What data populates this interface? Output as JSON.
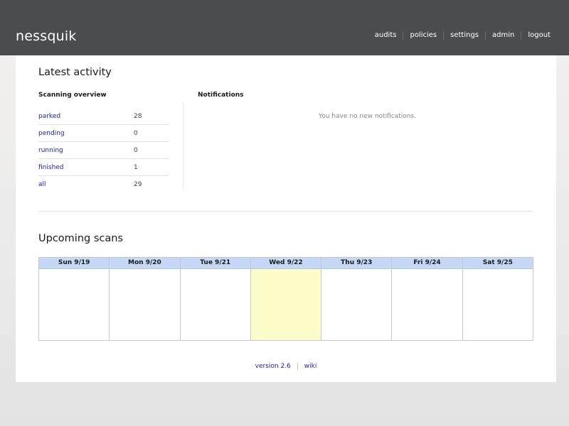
{
  "header": {
    "brand": "nessquik",
    "nav": [
      {
        "label": "audits"
      },
      {
        "label": "policies"
      },
      {
        "label": "settings"
      },
      {
        "label": "admin"
      },
      {
        "label": "logout"
      }
    ]
  },
  "latest_activity": {
    "title": "Latest activity",
    "scanning_overview": {
      "heading": "Scanning overview",
      "rows": [
        {
          "label": "parked",
          "count": "28"
        },
        {
          "label": "pending",
          "count": "0"
        },
        {
          "label": "running",
          "count": "0"
        },
        {
          "label": "finished",
          "count": "1"
        },
        {
          "label": "all",
          "count": "29"
        }
      ]
    },
    "notifications": {
      "heading": "Notifications",
      "empty_text": "You have no new notifications."
    }
  },
  "upcoming_scans": {
    "title": "Upcoming scans",
    "days": [
      {
        "label": "Sun 9/19",
        "today": false
      },
      {
        "label": "Mon 9/20",
        "today": false
      },
      {
        "label": "Tue 9/21",
        "today": false
      },
      {
        "label": "Wed 9/22",
        "today": true
      },
      {
        "label": "Thu 9/23",
        "today": false
      },
      {
        "label": "Fri 9/24",
        "today": false
      },
      {
        "label": "Sat 9/25",
        "today": false
      }
    ]
  },
  "footer": {
    "version": "version 2.6",
    "wiki": "wiki"
  },
  "colors": {
    "header_bg": "#4a4d50",
    "link": "#1a20c8",
    "calendar_header_bg": "#c5d9f7",
    "today_bg": "#fdfdc9"
  }
}
